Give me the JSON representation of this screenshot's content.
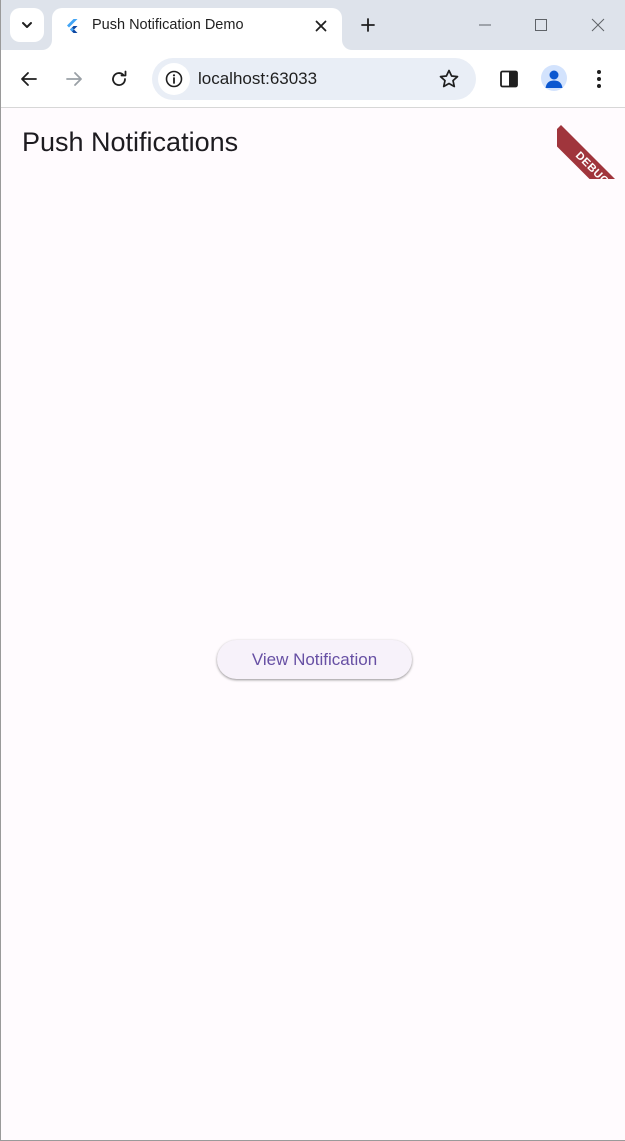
{
  "browser": {
    "tab": {
      "title": "Push Notification Demo"
    },
    "address_bar": {
      "url": "localhost:63033"
    }
  },
  "app": {
    "title": "Push Notifications",
    "view_button_label": "View Notification",
    "debug_banner": "DEBUG"
  },
  "colors": {
    "page_background": "#fffbfe",
    "button_text": "#6750a4",
    "button_background": "#f7f2fa",
    "debug_ribbon": "#a0353c",
    "tabstrip": "#dee3eb"
  }
}
